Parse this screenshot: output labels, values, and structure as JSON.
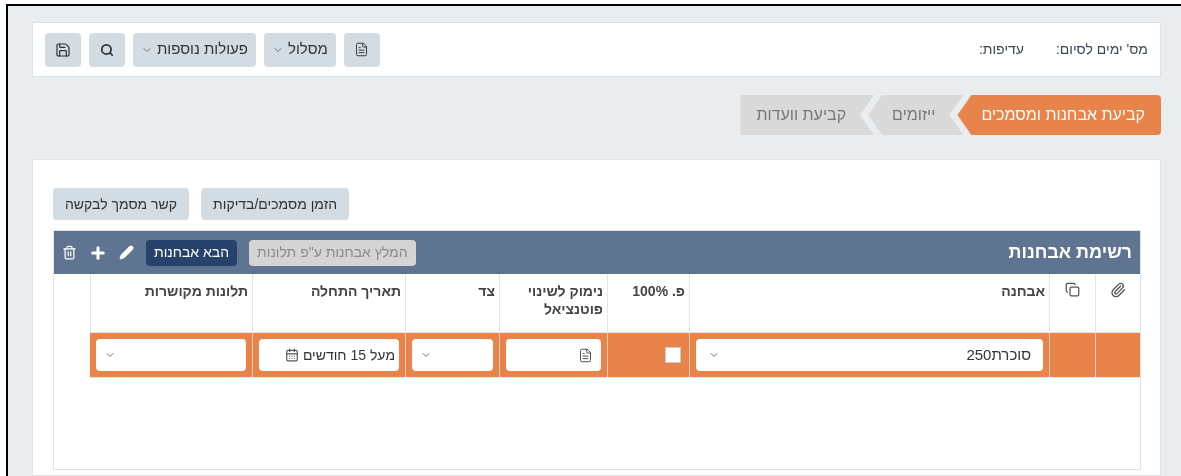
{
  "header": {
    "fields": [
      {
        "label": "מס' ימים לסיום:"
      },
      {
        "label": "עדיפות:"
      }
    ],
    "toolbar": [
      {
        "kind": "new"
      },
      {
        "kind": "dropdown",
        "label": "מסלול"
      },
      {
        "kind": "dropdown",
        "label": "פעולות נוספות"
      },
      {
        "kind": "search"
      },
      {
        "kind": "save"
      }
    ]
  },
  "steps": [
    {
      "label": "קביעת אבחנות ומסמכים",
      "selected": true
    },
    {
      "label": "ייזומים",
      "selected": false
    },
    {
      "label": "קביעת וועדות",
      "selected": false
    }
  ],
  "actions": [
    "הזמן מסמכים/בדיקות",
    "קשר מסמך לבקשה"
  ],
  "grid": {
    "title": "רשימת אבחנות",
    "tools": [
      {
        "kind": "disabled",
        "label": "המלץ אבחנות ע\"פ תלונות"
      },
      {
        "kind": "primary",
        "label": "הבא אבחנות"
      },
      {
        "kind": "edit"
      },
      {
        "kind": "add"
      },
      {
        "kind": "delete"
      }
    ],
    "columns": [
      {
        "kind": "attach"
      },
      {
        "kind": "copy"
      },
      {
        "kind": "text",
        "label": "אבחנה"
      },
      {
        "kind": "text",
        "label": "פ. 100%"
      },
      {
        "kind": "text",
        "label": "נימוק לשינוי פוטנציאל"
      },
      {
        "kind": "text",
        "label": "צד"
      },
      {
        "kind": "text",
        "label": "תאריך התחלה"
      },
      {
        "kind": "text",
        "label": "תלונות מקושרות"
      }
    ],
    "rows": [
      {
        "selected": true,
        "diagnosis": "סוכרת250",
        "full_percent_checked": false,
        "start_date": "מעל 15 חודשים"
      }
    ]
  }
}
